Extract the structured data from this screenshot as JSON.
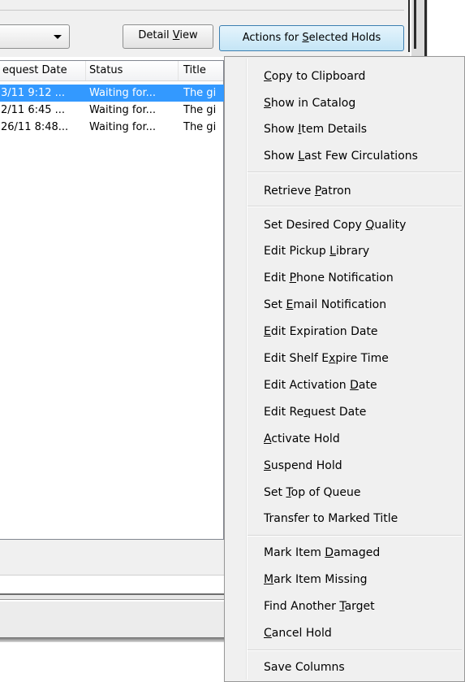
{
  "toolbar": {
    "detail_view": {
      "pre": "Detail ",
      "ul": "V",
      "post": "iew"
    },
    "actions": {
      "pre": "Actions for ",
      "ul": "S",
      "post": "elected Holds"
    }
  },
  "list": {
    "columns": [
      "equest Date",
      "Status",
      "Title"
    ],
    "rows": [
      {
        "date": "3/11 9:12 ...",
        "status": "Waiting for...",
        "title": "The gi"
      },
      {
        "date": "2/11 6:45 ...",
        "status": "Waiting for...",
        "title": "The gi"
      },
      {
        "date": "26/11 8:48...",
        "status": "Waiting for...",
        "title": "The gi"
      }
    ]
  },
  "menu": {
    "items": [
      {
        "pre": "",
        "ul": "C",
        "post": "opy to Clipboard"
      },
      {
        "pre": "",
        "ul": "S",
        "post": "how in Catalog"
      },
      {
        "pre": "Show ",
        "ul": "I",
        "post": "tem Details"
      },
      {
        "pre": "Show ",
        "ul": "L",
        "post": "ast Few Circulations"
      },
      {
        "pre": "Retrieve ",
        "ul": "P",
        "post": "atron"
      },
      {
        "pre": "Set Desired Copy ",
        "ul": "Q",
        "post": "uality"
      },
      {
        "pre": "Edit Pickup ",
        "ul": "L",
        "post": "ibrary"
      },
      {
        "pre": "Edit ",
        "ul": "P",
        "post": "hone Notification"
      },
      {
        "pre": "Set ",
        "ul": "E",
        "post": "mail Notification"
      },
      {
        "pre": "",
        "ul": "E",
        "post": "dit Expiration Date"
      },
      {
        "pre": "Edit Shelf E",
        "ul": "x",
        "post": "pire Time"
      },
      {
        "pre": "Edit Activation ",
        "ul": "D",
        "post": "ate"
      },
      {
        "pre": "Edit Re",
        "ul": "q",
        "post": "uest Date"
      },
      {
        "pre": "",
        "ul": "A",
        "post": "ctivate Hold"
      },
      {
        "pre": "",
        "ul": "S",
        "post": "uspend Hold"
      },
      {
        "pre": "Set ",
        "ul": "T",
        "post": "op of Queue"
      },
      {
        "pre": "Transfer to Marked Title",
        "ul": "",
        "post": ""
      },
      {
        "pre": "Mark Item ",
        "ul": "D",
        "post": "amaged"
      },
      {
        "pre": "",
        "ul": "M",
        "post": "ark Item Missing"
      },
      {
        "pre": "Find Another ",
        "ul": "T",
        "post": "arget"
      },
      {
        "pre": "",
        "ul": "C",
        "post": "ancel Hold"
      },
      {
        "pre": "Save Columns",
        "ul": "",
        "post": ""
      }
    ]
  }
}
